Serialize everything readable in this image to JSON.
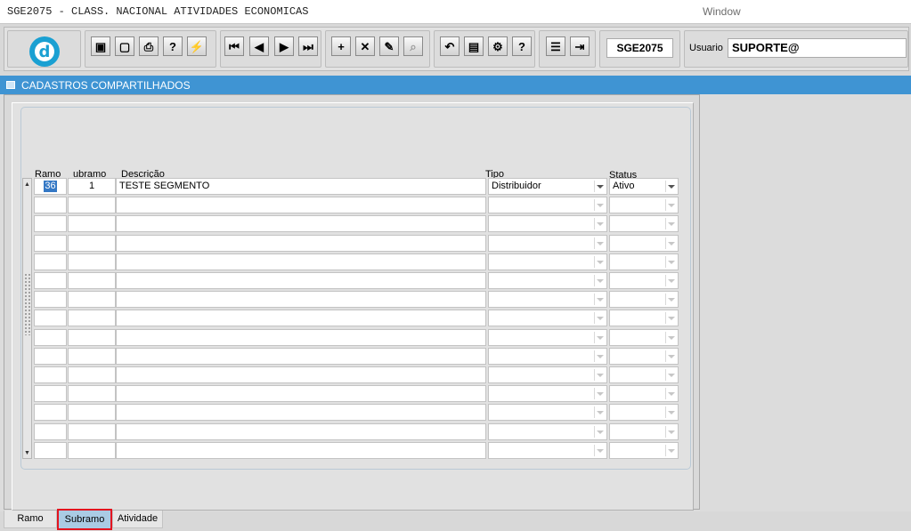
{
  "app": {
    "title": "SGE2075 - CLASS. NACIONAL ATIVIDADES ECONOMICAS",
    "window_menu": "Window"
  },
  "toolbar": {
    "logo_letter": "d",
    "form_code": "SGE2075",
    "user_label": "Usuario",
    "user_value": "SUPORTE@",
    "buttons": [
      {
        "icon": "save-icon",
        "glyph": "▣"
      },
      {
        "icon": "window-icon",
        "glyph": "▢"
      },
      {
        "icon": "print-icon",
        "glyph": "⎙"
      },
      {
        "icon": "query-help-icon",
        "glyph": "?"
      },
      {
        "icon": "execute-query-icon",
        "glyph": "⚡"
      },
      {
        "icon": "first-record-icon",
        "glyph": "⏮"
      },
      {
        "icon": "previous-record-icon",
        "glyph": "◀"
      },
      {
        "icon": "next-record-icon",
        "glyph": "▶"
      },
      {
        "icon": "last-record-icon",
        "glyph": "⏭"
      },
      {
        "icon": "insert-record-icon",
        "glyph": "+"
      },
      {
        "icon": "delete-record-icon",
        "glyph": "✕"
      },
      {
        "icon": "edit-record-icon",
        "glyph": "✎"
      },
      {
        "icon": "lookup-icon",
        "glyph": "⌕"
      },
      {
        "icon": "undo-icon",
        "glyph": "↶"
      },
      {
        "icon": "clipboard-icon",
        "glyph": "▤"
      },
      {
        "icon": "tools-icon",
        "glyph": "⚙"
      },
      {
        "icon": "help-icon",
        "glyph": "?"
      },
      {
        "icon": "menu-icon",
        "glyph": "☰"
      },
      {
        "icon": "exit-icon",
        "glyph": "⇥"
      }
    ]
  },
  "window": {
    "title": "CADASTROS COMPARTILHADOS"
  },
  "grid": {
    "headers": {
      "ramo": "Ramo",
      "subramo": "ubramo",
      "descricao": "Descrição",
      "tipo": "Tipo",
      "status": "Status"
    },
    "rows": [
      {
        "ramo": "36",
        "subramo": "1",
        "descricao": "TESTE SEGMENTO",
        "tipo": "Distribuidor",
        "status": "Ativo"
      },
      {
        "ramo": "",
        "subramo": "",
        "descricao": "",
        "tipo": "",
        "status": ""
      },
      {
        "ramo": "",
        "subramo": "",
        "descricao": "",
        "tipo": "",
        "status": ""
      },
      {
        "ramo": "",
        "subramo": "",
        "descricao": "",
        "tipo": "",
        "status": ""
      },
      {
        "ramo": "",
        "subramo": "",
        "descricao": "",
        "tipo": "",
        "status": ""
      },
      {
        "ramo": "",
        "subramo": "",
        "descricao": "",
        "tipo": "",
        "status": ""
      },
      {
        "ramo": "",
        "subramo": "",
        "descricao": "",
        "tipo": "",
        "status": ""
      },
      {
        "ramo": "",
        "subramo": "",
        "descricao": "",
        "tipo": "",
        "status": ""
      },
      {
        "ramo": "",
        "subramo": "",
        "descricao": "",
        "tipo": "",
        "status": ""
      },
      {
        "ramo": "",
        "subramo": "",
        "descricao": "",
        "tipo": "",
        "status": ""
      },
      {
        "ramo": "",
        "subramo": "",
        "descricao": "",
        "tipo": "",
        "status": ""
      },
      {
        "ramo": "",
        "subramo": "",
        "descricao": "",
        "tipo": "",
        "status": ""
      },
      {
        "ramo": "",
        "subramo": "",
        "descricao": "",
        "tipo": "",
        "status": ""
      },
      {
        "ramo": "",
        "subramo": "",
        "descricao": "",
        "tipo": "",
        "status": ""
      },
      {
        "ramo": "",
        "subramo": "",
        "descricao": "",
        "tipo": "",
        "status": ""
      }
    ]
  },
  "tabs": [
    {
      "label": "Ramo",
      "active": false
    },
    {
      "label": "Subramo",
      "active": true
    },
    {
      "label": "Atividade",
      "active": false
    }
  ],
  "colors": {
    "accent": "#3f94d3",
    "selection": "#3478c5",
    "active_tab_border": "#e3141f"
  }
}
